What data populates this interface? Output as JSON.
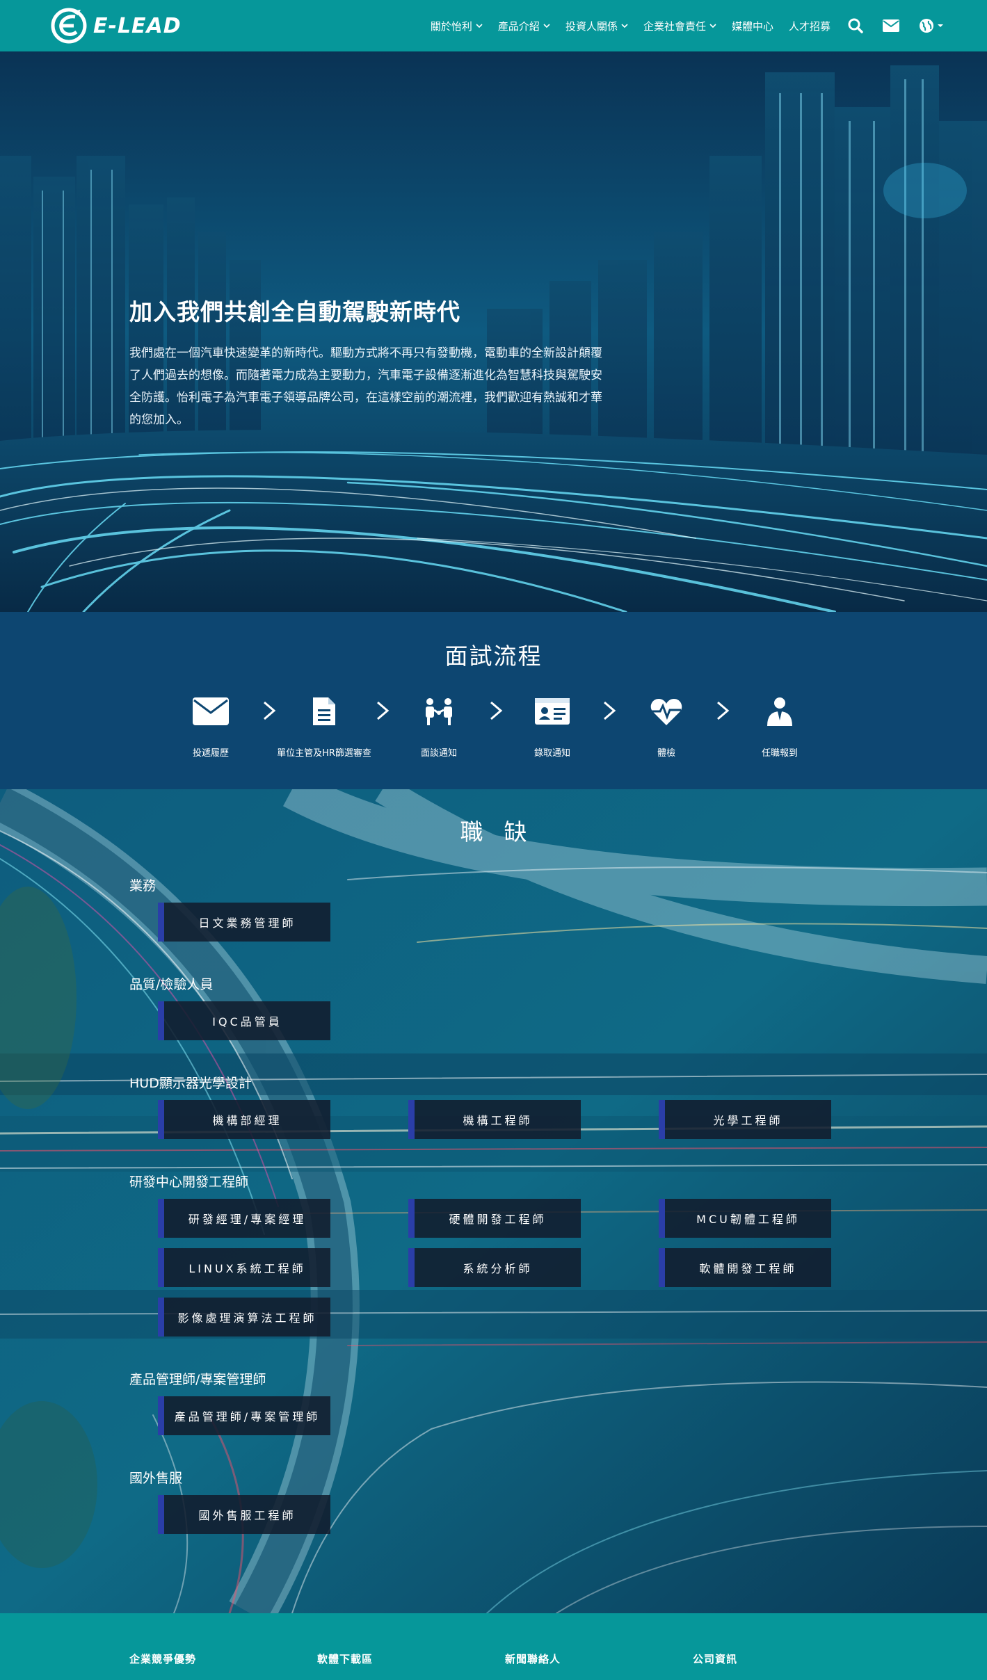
{
  "nav": {
    "logo_text": "E-LEAD",
    "items": [
      {
        "label": "關於怡利",
        "has_dropdown": true
      },
      {
        "label": "產品介紹",
        "has_dropdown": true
      },
      {
        "label": "投資人關係",
        "has_dropdown": true
      },
      {
        "label": "企業社會責任",
        "has_dropdown": true
      },
      {
        "label": "媒體中心",
        "has_dropdown": false
      },
      {
        "label": "人才招募",
        "has_dropdown": false
      }
    ],
    "icons": [
      "search-icon",
      "mail-icon",
      "globe-icon"
    ]
  },
  "hero": {
    "title": "加入我們共創全自動駕駛新時代",
    "text": "我們處在一個汽車快速變革的新時代。驅動方式將不再只有發動機，電動車的全新設計顛覆了人們過去的想像。而隨著電力成為主要動力，汽車電子設備逐漸進化為智慧科技與駕駛安全防護。怡利電子為汽車電子領導品牌公司，在這樣空前的潮流裡，我們歡迎有熱誠和才華的您加入。"
  },
  "process": {
    "title": "面試流程",
    "steps": [
      {
        "label": "投遞履歷",
        "icon": "envelope-icon"
      },
      {
        "label": "單位主管及HR篩選審查",
        "icon": "document-icon"
      },
      {
        "label": "面談通知",
        "icon": "interview-icon"
      },
      {
        "label": "錄取通知",
        "icon": "id-card-icon"
      },
      {
        "label": "體檢",
        "icon": "heartbeat-icon"
      },
      {
        "label": "任職報到",
        "icon": "employee-icon"
      }
    ]
  },
  "jobs": {
    "title": "職缺",
    "categories": [
      {
        "name": "業務",
        "positions": [
          "日文業務管理師"
        ]
      },
      {
        "name": "品質/檢驗人員",
        "positions": [
          "IQC品管員"
        ]
      },
      {
        "name": "HUD顯示器光學設計",
        "positions": [
          "機構部經理",
          "機構工程師",
          "光學工程師"
        ]
      },
      {
        "name": "研發中心開發工程師",
        "positions": [
          "研發經理/專案經理",
          "硬體開發工程師",
          "MCU韌體工程師",
          "LINUX系統工程師",
          "系統分析師",
          "軟體開發工程師",
          "影像處理演算法工程師"
        ]
      },
      {
        "name": "產品管理師/專案管理師",
        "positions": [
          "產品管理師/專案管理師"
        ]
      },
      {
        "name": "國外售服",
        "positions": [
          "國外售服工程師"
        ]
      }
    ]
  },
  "footer": {
    "links": [
      "企業競爭優勢",
      "軟體下載區",
      "新聞聯絡人",
      "公司資訊"
    ]
  },
  "colors": {
    "nav_bg": "#06979a",
    "process_bg": "#0d4671",
    "job_accent": "#2a3ea8",
    "job_bg": "#121c2d"
  }
}
